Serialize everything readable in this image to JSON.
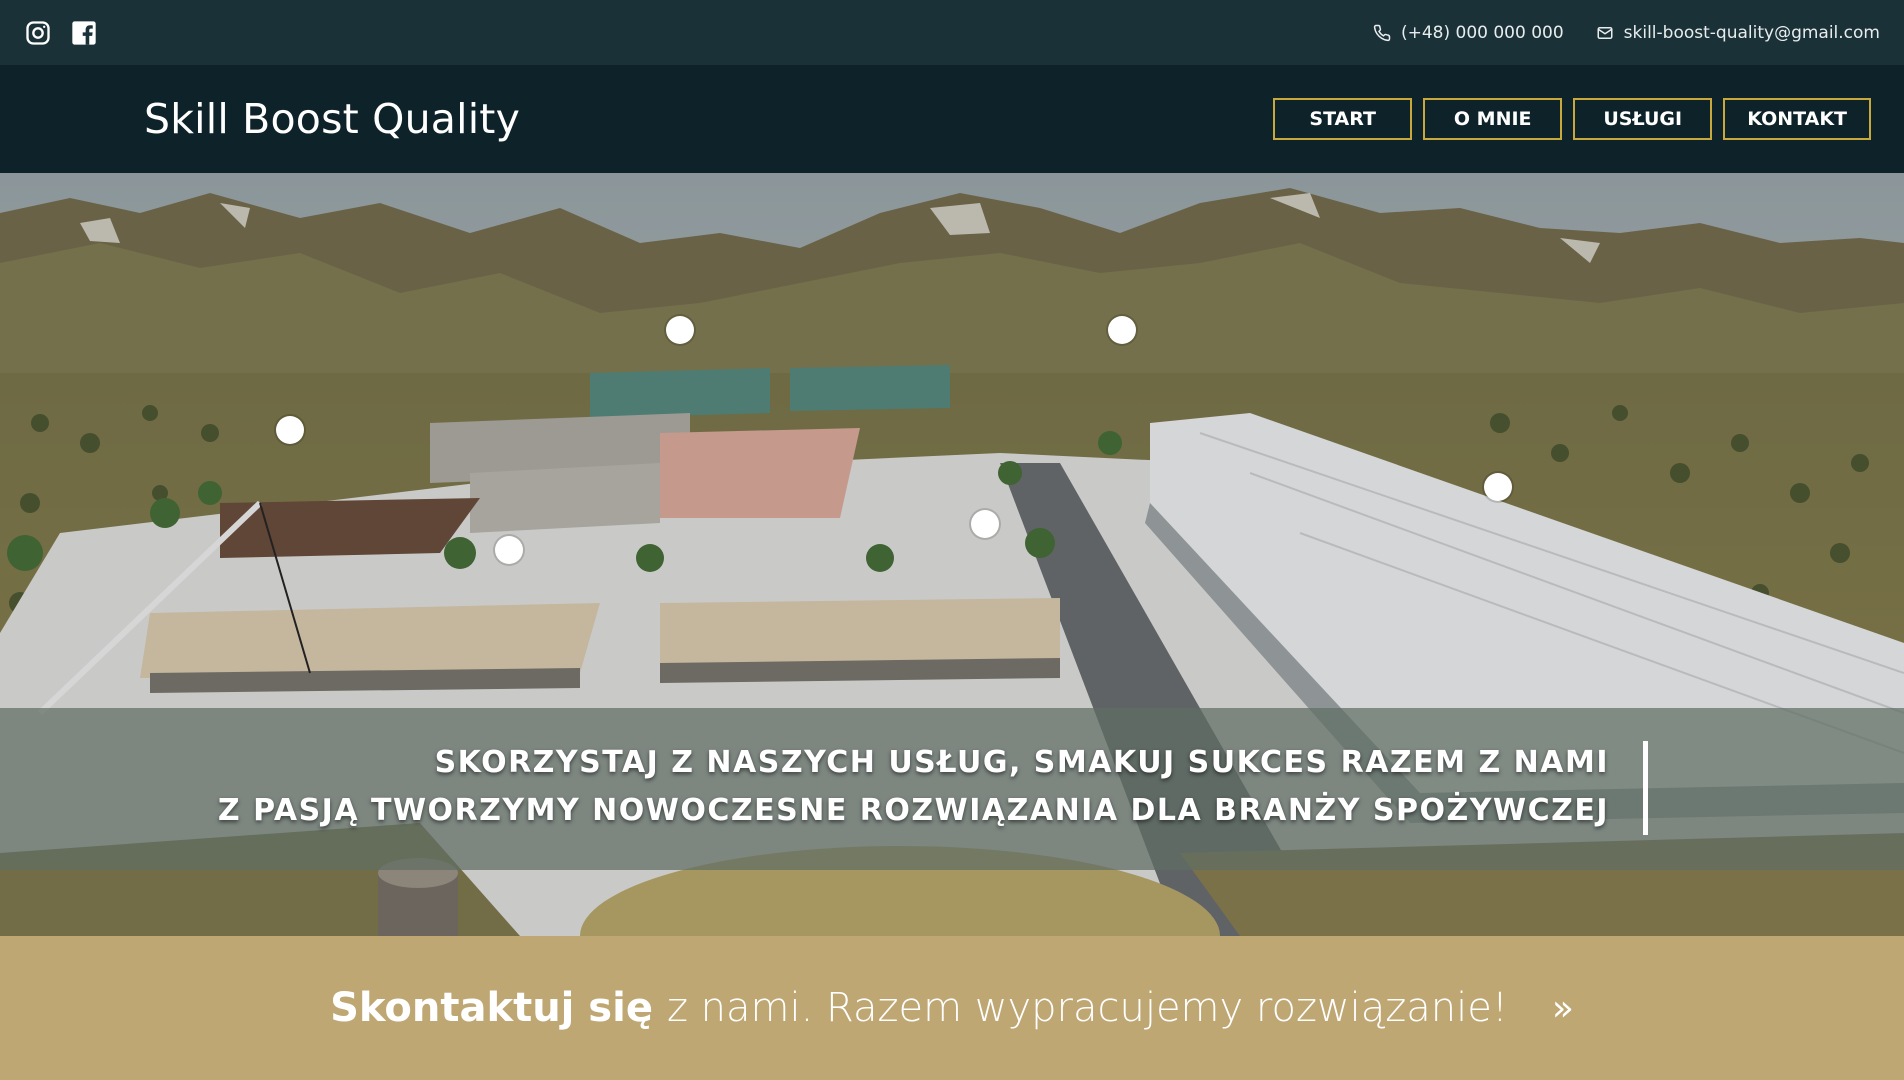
{
  "topbar": {
    "social": [
      {
        "icon": "instagram-icon"
      },
      {
        "icon": "facebook-icon"
      }
    ],
    "phone": "(+48) 000 000 000",
    "email": "skill-boost-quality@gmail.com"
  },
  "header": {
    "brand": "Skill Boost Quality",
    "nav": [
      "START",
      "O MNIE",
      "USŁUGI",
      "KONTAKT"
    ]
  },
  "hero": {
    "line1": "SKORZYSTAJ Z NASZYCH USŁUG, SMAKUJ SUKCES RAZEM Z NAMI",
    "line2": "Z PASJĄ TWORZYMY NOWOCZESNE ROZWIĄZANIA DLA BRANŻY SPOŻYWCZEJ"
  },
  "cta": {
    "strong": "Skontaktuj się",
    "light": "z nami.  Razem wypracujemy rozwiązanie!",
    "arrow": "»"
  },
  "colors": {
    "topbar": "#1b3138",
    "header": "#0d2229",
    "accent": "#c9a93c",
    "cta": "#bfa774"
  }
}
